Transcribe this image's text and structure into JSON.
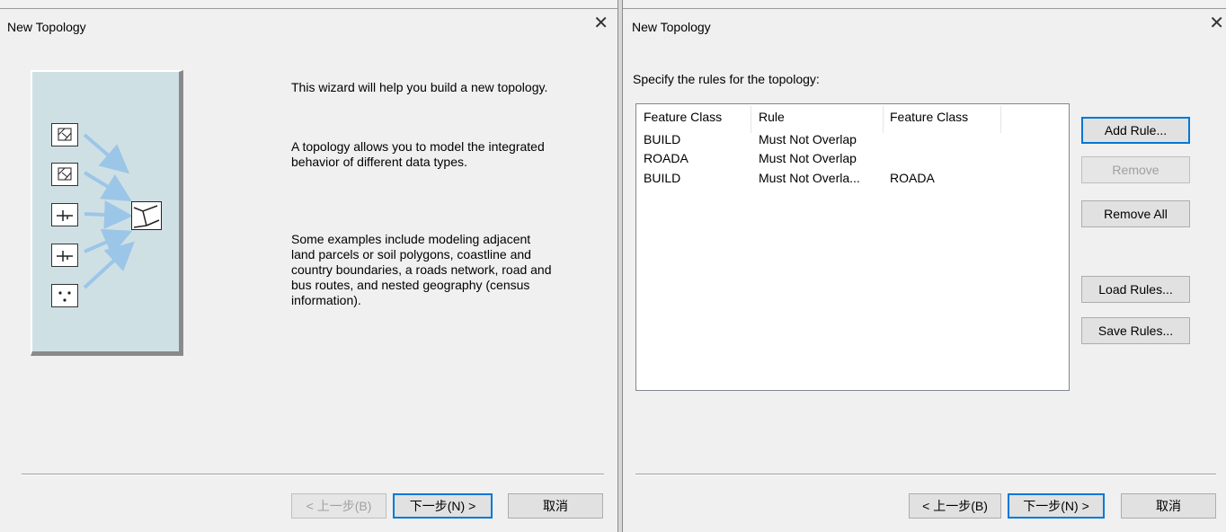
{
  "left_dialog": {
    "title": "New Topology",
    "close_glyph": "✕",
    "paragraphs": [
      "This wizard will help you build a new topology.",
      "A topology allows you to model the integrated behavior of different data types.",
      "Some examples include modeling adjacent land parcels or soil polygons, coastline and country boundaries, a roads network, road and bus routes, and nested geography (census information)."
    ],
    "buttons": {
      "back": "< 上一步(B)",
      "next": "下一步(N) >",
      "cancel": "取消"
    }
  },
  "right_dialog": {
    "title": "New Topology",
    "close_glyph": "✕",
    "prompt": "Specify the rules for the topology:",
    "columns": [
      "Feature Class",
      "Rule",
      "Feature Class"
    ],
    "rows": [
      [
        "BUILD",
        "Must Not Overlap",
        ""
      ],
      [
        "ROADA",
        "Must Not Overlap",
        ""
      ],
      [
        "BUILD",
        "Must Not Overla...",
        "ROADA"
      ]
    ],
    "side_buttons": {
      "add_rule": "Add Rule...",
      "remove": "Remove",
      "remove_all": "Remove All",
      "load_rules": "Load Rules...",
      "save_rules": "Save Rules..."
    },
    "buttons": {
      "back": "< 上一步(B)",
      "next": "下一步(N) >",
      "cancel": "取消"
    }
  },
  "colors": {
    "accent": "#0078d7",
    "dialog_bg": "#f0f0f0",
    "art_bg": "#cfe0e4",
    "arrow": "#9cc6e8"
  },
  "icons": [
    "polygon-layer-icon",
    "polygon-layer-icon",
    "line-layer-icon",
    "line-layer-icon",
    "point-layer-icon",
    "topology-icon",
    "arrow-icon"
  ]
}
